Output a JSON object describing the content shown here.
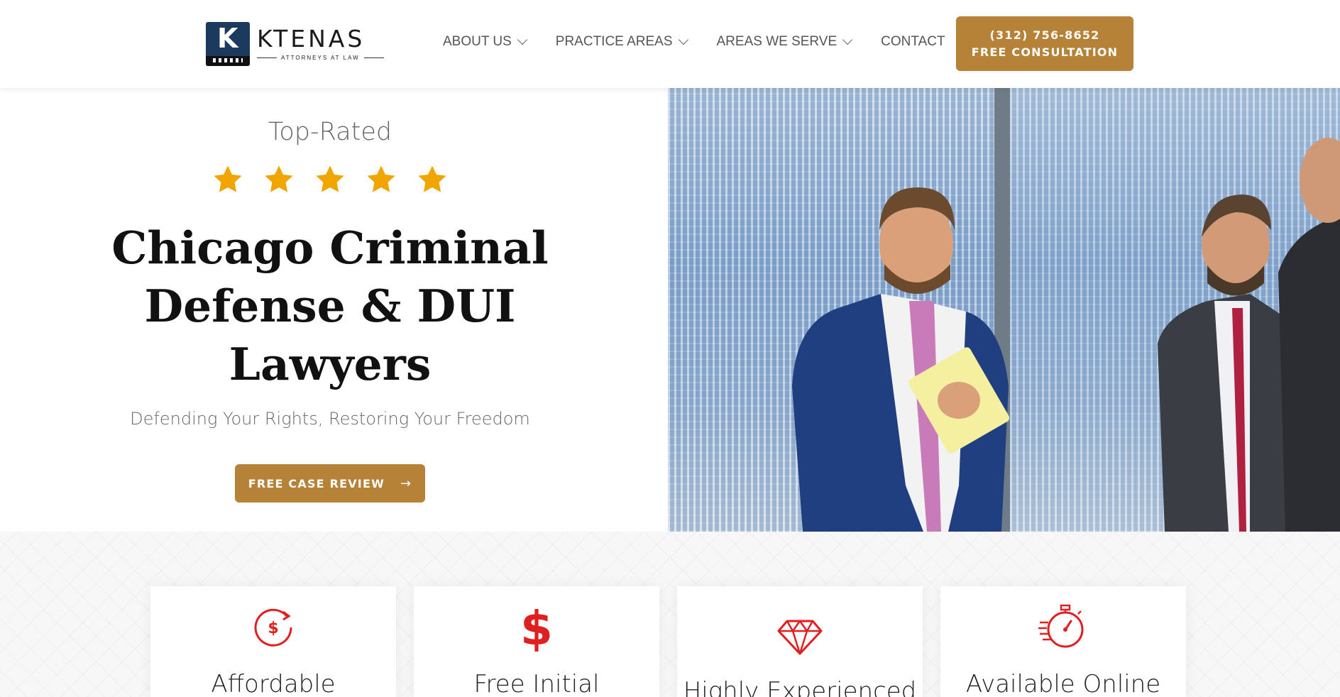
{
  "header": {
    "logo": {
      "name": "KTENAS",
      "sub": "ATTORNEYS AT LAW",
      "mark_letter": "K"
    },
    "nav": [
      {
        "label": "ABOUT US",
        "dropdown": true
      },
      {
        "label": "PRACTICE AREAS",
        "dropdown": true
      },
      {
        "label": "AREAS WE SERVE",
        "dropdown": true
      },
      {
        "label": "CONTACT",
        "dropdown": false
      }
    ],
    "cta": {
      "phone": "(312) 756-8652",
      "label": "FREE CONSULTATION"
    }
  },
  "hero": {
    "kicker": "Top-Rated",
    "rating": 5,
    "headline_lines": [
      "Chicago Criminal",
      "Defense & DUI",
      "Lawyers"
    ],
    "tagline": "Defending Your Rights, Restoring Your Freedom",
    "button": {
      "label": "FREE CASE REVIEW",
      "icon": "arrow-right-icon"
    }
  },
  "features": [
    {
      "title": "Affordable",
      "icon": "dollar-refresh-icon"
    },
    {
      "title": "Free Initial",
      "icon": "dollar-sign-icon"
    },
    {
      "title": "Highly Experienced",
      "icon": "diamond-icon"
    },
    {
      "title": "Available Online",
      "icon": "stopwatch-icon"
    }
  ],
  "colors": {
    "accent": "#b58238",
    "star": "#f0a500",
    "icon_red": "#e02020",
    "navy": "#1c3a5e"
  }
}
